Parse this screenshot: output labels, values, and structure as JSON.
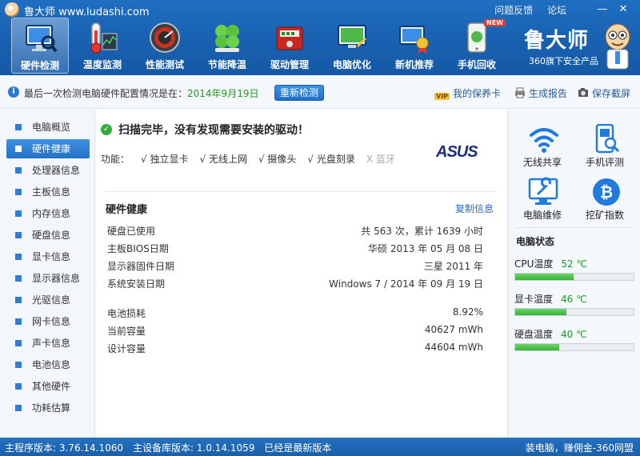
{
  "titlebar": {
    "title": "鲁大师 www.ludashi.com",
    "links": [
      "问题反馈",
      "论坛"
    ],
    "min": "—",
    "close": "✕"
  },
  "nav": [
    {
      "label": "硬件检测",
      "icon": "monitor-magnifier-icon",
      "active": true
    },
    {
      "label": "温度监测",
      "icon": "thermometer-icon"
    },
    {
      "label": "性能测试",
      "icon": "speedometer-icon"
    },
    {
      "label": "节能降温",
      "icon": "clover-icon"
    },
    {
      "label": "驱动管理",
      "icon": "driver-box-icon"
    },
    {
      "label": "电脑优化",
      "icon": "optimize-screen-icon"
    },
    {
      "label": "新机推荐",
      "icon": "medal-monitor-icon"
    },
    {
      "label": "手机回收",
      "icon": "phone-recycle-icon",
      "badge": "NEW"
    }
  ],
  "brand": {
    "name": "鲁大师",
    "sub": "360旗下安全产品"
  },
  "infobar": {
    "text_prefix": "最后一次检测电脑硬件配置情况是在：",
    "date": "2014年9月19日",
    "recheck": "重新检测",
    "warranty": "我的保养卡",
    "warranty_badge": "VIP",
    "report": "生成报告",
    "screenshot": "保存截屏"
  },
  "sidebar": [
    {
      "label": "电脑概览"
    },
    {
      "label": "硬件健康",
      "active": true
    },
    {
      "label": "处理器信息"
    },
    {
      "label": "主板信息"
    },
    {
      "label": "内存信息"
    },
    {
      "label": "硬盘信息"
    },
    {
      "label": "显卡信息"
    },
    {
      "label": "显示器信息"
    },
    {
      "label": "光驱信息"
    },
    {
      "label": "网卡信息"
    },
    {
      "label": "声卡信息"
    },
    {
      "label": "电池信息"
    },
    {
      "label": "其他硬件"
    },
    {
      "label": "功耗估算"
    }
  ],
  "main": {
    "scan_title": "扫描完毕，没有发现需要安装的驱动！",
    "features_label": "功能：",
    "features": [
      {
        "label": "√ 独立显卡",
        "on": true
      },
      {
        "label": "√ 无线上网",
        "on": true
      },
      {
        "label": "√ 摄像头",
        "on": true
      },
      {
        "label": "√ 光盘刻录",
        "on": true
      },
      {
        "label": "X 蓝牙",
        "on": false
      }
    ],
    "vendor_logo": "ASUS",
    "section_title": "硬件健康",
    "copy_link": "复制信息",
    "rows": [
      {
        "k": "硬盘已使用",
        "v": "共 563 次，累计 1639 小时"
      },
      {
        "k": "主板BIOS日期",
        "v": "华硕 2013 年 05 月 08 日"
      },
      {
        "k": "显示器固件日期",
        "v": "三星 2011 年"
      },
      {
        "k": "系统安装日期",
        "v": "Windows 7 / 2014 年 09 月 19 日"
      }
    ],
    "battery_rows": [
      {
        "k": "电池损耗",
        "v": "8.92%"
      },
      {
        "k": "当前容量",
        "v": "40627 mWh"
      },
      {
        "k": "设计容量",
        "v": "44604 mWh"
      }
    ]
  },
  "rpanel": {
    "tools": [
      {
        "label": "无线共享",
        "icon": "wifi-icon"
      },
      {
        "label": "手机评测",
        "icon": "phone-scan-icon"
      },
      {
        "label": "电脑维修",
        "icon": "wrench-screen-icon"
      },
      {
        "label": "挖矿指数",
        "icon": "bitcoin-icon"
      }
    ],
    "status_title": "电脑状态",
    "temps": [
      {
        "label": "CPU温度",
        "value": "52 ℃",
        "fill": 0.49
      },
      {
        "label": "显卡温度",
        "value": "46 ℃",
        "fill": 0.43
      },
      {
        "label": "硬盘温度",
        "value": "40 ℃",
        "fill": 0.37
      }
    ]
  },
  "footer": {
    "items": [
      "主程序版本: 3.76.14.1060",
      "主设备库版本: 1.0.14.1059",
      "已经是最新版本"
    ],
    "right": "装电脑，赚佣金-360网盟"
  },
  "colors": {
    "header": "#1a63b3",
    "accent": "#2f7dd6",
    "green": "#1d9a1d"
  }
}
